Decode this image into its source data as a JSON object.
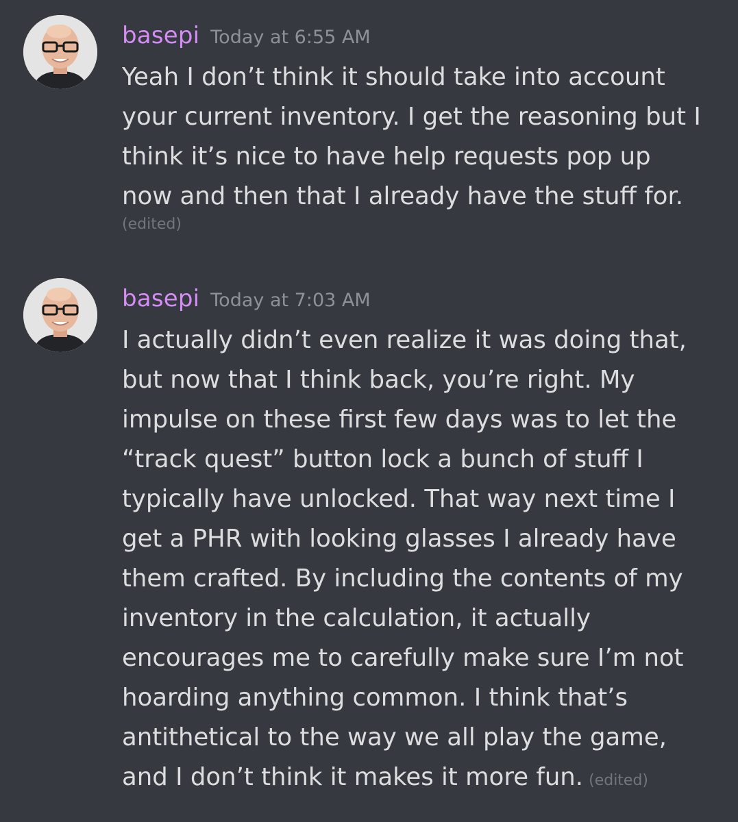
{
  "messages": [
    {
      "username": "basepi",
      "timestamp": "Today at 6:55 AM",
      "lines": [
        "Yeah I don’t think it should take into account",
        "your current inventory. I get the reasoning but I",
        "think it’s nice to have help requests pop up",
        "now and then that I already have the stuff for."
      ],
      "edited_label": "(edited)"
    },
    {
      "username": "basepi",
      "timestamp": "Today at 7:03 AM",
      "lines": [
        "I actually didn’t even realize it was doing that,",
        "but now that I think back, you’re right. My",
        "impulse on these first few days was to let the",
        "“track quest” button lock a bunch of stuff I",
        "typically have unlocked. That way next time I",
        "get a PHR with looking glasses I already have",
        "them crafted. By including the contents of my",
        "inventory in the calculation, it actually",
        "encourages me to carefully make sure I’m not",
        "hoarding anything common. I think that’s",
        "antithetical to the way we all play the game,",
        "and I don’t think it makes it more fun."
      ],
      "edited_label": "(edited)"
    }
  ],
  "colors": {
    "background": "#36393f",
    "username": "#d68cf5",
    "message_text": "#dcddde",
    "timestamp": "#8e9297",
    "edited": "#72767d"
  },
  "icons": {
    "avatar": "user-avatar-bald-man-with-glasses"
  }
}
